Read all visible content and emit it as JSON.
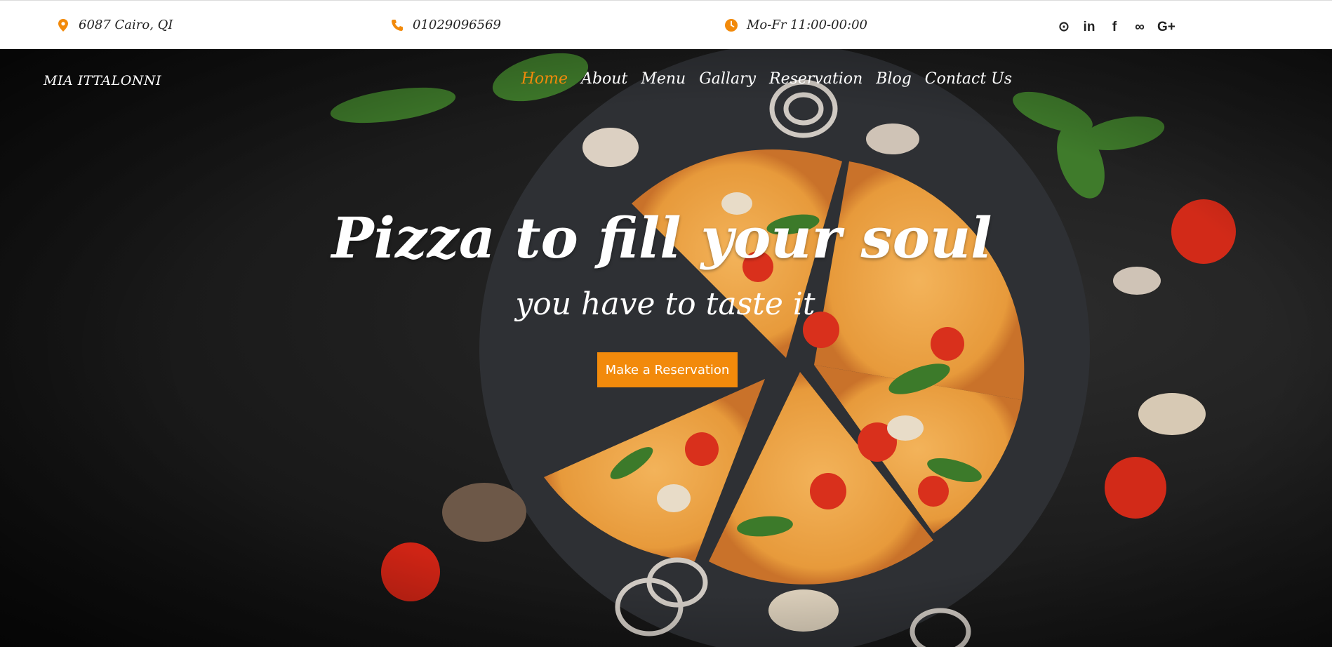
{
  "topbar": {
    "address": "6087 Cairo, QI",
    "phone": "01029096569",
    "hours": "Mo-Fr 11:00-00:00",
    "icon_color": "#f28a0b",
    "socials": [
      {
        "icon": "github-icon",
        "glyph": "⊙"
      },
      {
        "icon": "linkedin-icon",
        "glyph": "in"
      },
      {
        "icon": "facebook-icon",
        "glyph": "f"
      },
      {
        "icon": "tripadvisor-icon",
        "glyph": "∞"
      },
      {
        "icon": "google-plus-icon",
        "glyph": "G+"
      }
    ]
  },
  "header": {
    "brand": "MIA ITTALONNI",
    "nav": [
      {
        "label": "Home",
        "active": true
      },
      {
        "label": "About",
        "active": false
      },
      {
        "label": "Menu",
        "active": false
      },
      {
        "label": "Gallary",
        "active": false
      },
      {
        "label": "Reservation",
        "active": false
      },
      {
        "label": "Blog",
        "active": false
      },
      {
        "label": "Contact Us",
        "active": false
      }
    ],
    "accent": "#f28a0b"
  },
  "hero": {
    "title": "Pizza to fill your soul",
    "subtitle": "you have to taste it",
    "cta_label": "Make a Reservation"
  }
}
